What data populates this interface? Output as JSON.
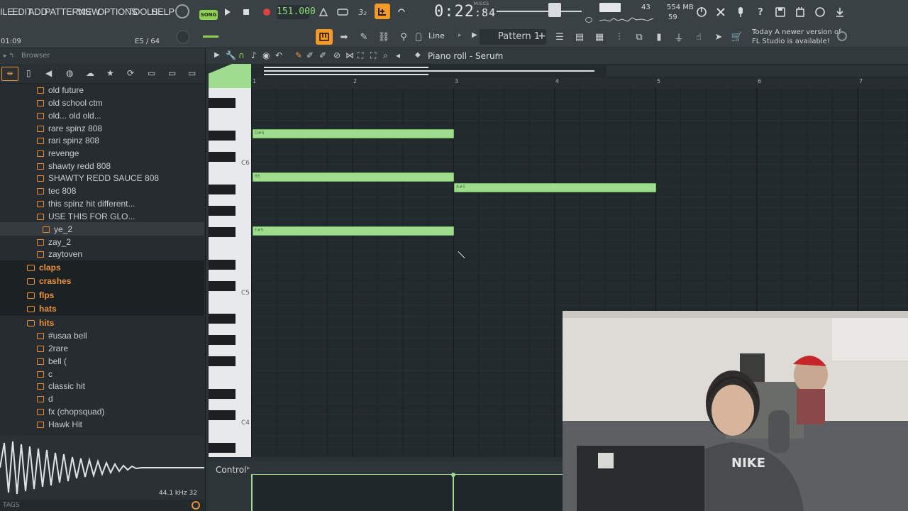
{
  "menu": [
    "ILE",
    "EDIT",
    "ADD",
    "PATTERNS",
    "VIEW",
    "OPTIONS",
    "TOOLS",
    "HELP"
  ],
  "transport": {
    "song_label": "SONG",
    "tempo": "151.000",
    "time_main": "0:22",
    "time_frac": "84",
    "time_unit": "M:S:CS"
  },
  "meters": {
    "cpu": "43",
    "memory": "554 MB",
    "polyphony": "59"
  },
  "hint_bar": {
    "position": "01:09",
    "step": "E5 / 64"
  },
  "toolbar2": {
    "snap": "Line",
    "pattern": "Pattern 1"
  },
  "news": {
    "line1": "Today  A newer version of",
    "line2": "FL Studio is available!"
  },
  "browser": {
    "title": "Browser",
    "items": [
      "old future",
      "old school ctm",
      "old... old old...",
      "rare spinz 808",
      "rari spinz 808",
      "revenge",
      "shawty redd 808",
      "SHAWTY REDD SAUCE 808",
      "tec 808",
      "this spinz hit different...",
      "USE THIS FOR GLO...",
      "ye_2",
      "zay_2",
      "zaytoven"
    ],
    "folders": [
      "claps",
      "crashes",
      "flps",
      "hats",
      "hits"
    ],
    "hit_items": [
      "#usaa bell",
      "2rare",
      "bell (",
      "c",
      "classic hit",
      "d",
      "fx (chopsquad)",
      "Hawk Hit"
    ],
    "sample_info": "44.1 kHz 32",
    "tags_label": "TAGS"
  },
  "piano_roll": {
    "title": "Piano roll - Serum",
    "bars": [
      "1",
      "2",
      "3",
      "4",
      "5",
      "6",
      "7"
    ],
    "key_labels": [
      "C6",
      "C5",
      "C4"
    ],
    "notes": [
      {
        "pitch": "D#6",
        "start": 1,
        "length": 2
      },
      {
        "pitch": "B5",
        "start": 1,
        "length": 2
      },
      {
        "pitch": "A#5",
        "start": 3,
        "length": 2
      },
      {
        "pitch": "F#5",
        "start": 1,
        "length": 2
      }
    ],
    "control_label": "Control"
  },
  "icons": [
    "play-icon",
    "stop-icon",
    "record-icon",
    "metronome-icon",
    "undo-icon",
    "save-icon",
    "help-icon"
  ],
  "colors": {
    "accent_orange": "#f49a25",
    "note_green": "#9fdc8e",
    "folder_orange": "#e8923a"
  }
}
